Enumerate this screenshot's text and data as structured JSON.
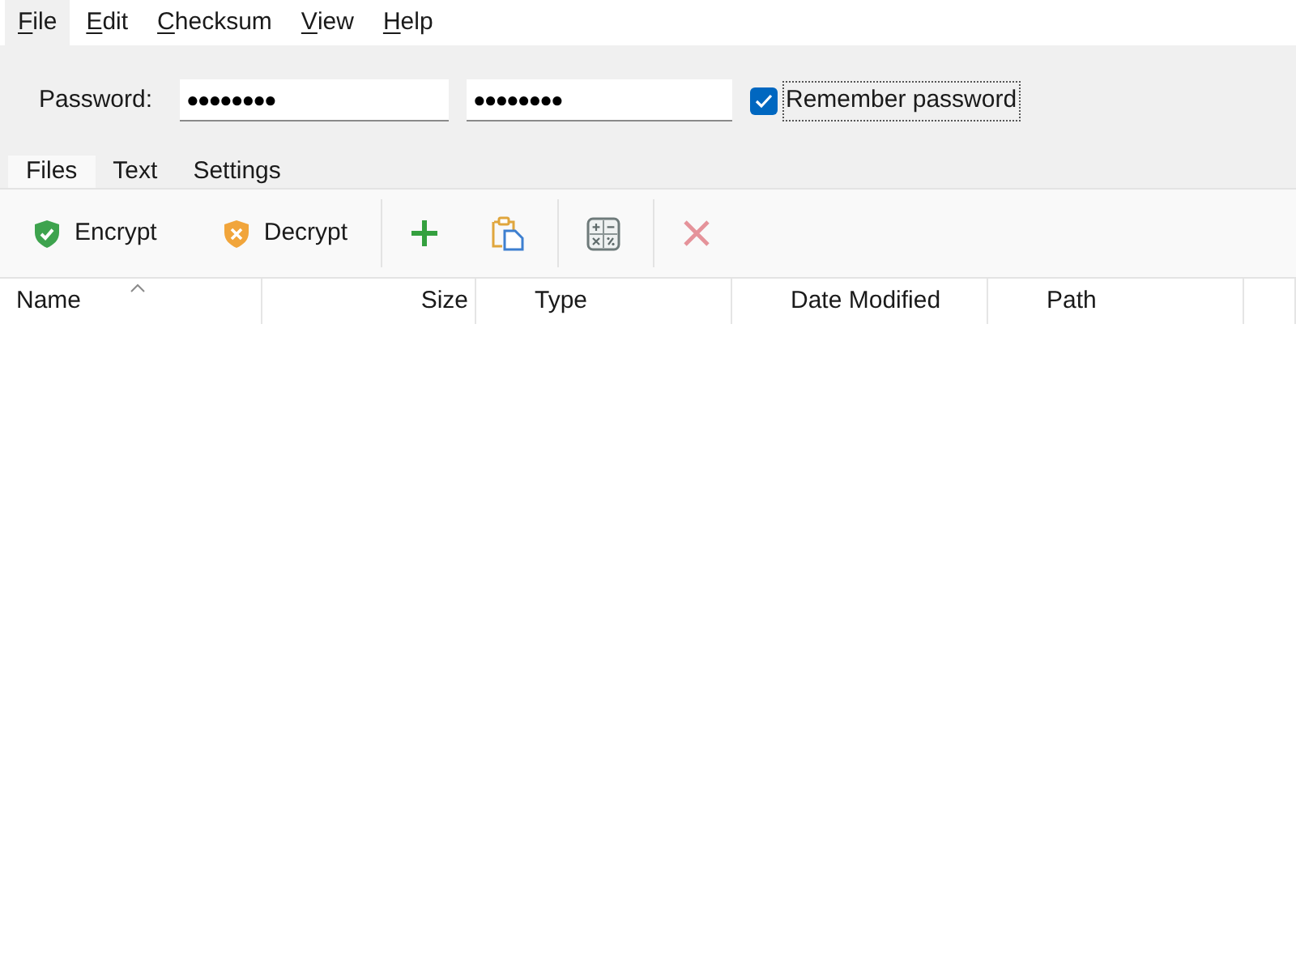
{
  "menu": [
    {
      "label": "File",
      "highlighted": true
    },
    {
      "label": "Edit",
      "highlighted": false
    },
    {
      "label": "Checksum",
      "highlighted": false
    },
    {
      "label": "View",
      "highlighted": false
    },
    {
      "label": "Help",
      "highlighted": false
    }
  ],
  "password_bar": {
    "label": "Password:",
    "fields": [
      {
        "value": "●●●●●●●●"
      },
      {
        "value": "●●●●●●●●"
      }
    ],
    "remember": {
      "label": "Remember password",
      "checked": true,
      "focused": true
    }
  },
  "tabs": [
    {
      "label": "Files",
      "selected": true
    },
    {
      "label": "Text",
      "selected": false
    },
    {
      "label": "Settings",
      "selected": false
    }
  ],
  "toolbar": {
    "groups": [
      [
        {
          "label": "Encrypt",
          "disabled": false
        },
        {
          "label": "Decrypt",
          "disabled": false
        }
      ],
      [
        {
          "disabled": false
        },
        {
          "disabled": false
        }
      ],
      [
        {
          "disabled": false
        }
      ],
      [
        {
          "disabled": true
        }
      ]
    ]
  },
  "table": {
    "columns": [
      {
        "label": "Name",
        "sorted": true
      },
      {
        "label": "Size",
        "sorted": false
      },
      {
        "label": "Type",
        "sorted": false
      },
      {
        "label": "Date Modified",
        "sorted": false
      },
      {
        "label": "Path",
        "sorted": false
      }
    ]
  }
}
